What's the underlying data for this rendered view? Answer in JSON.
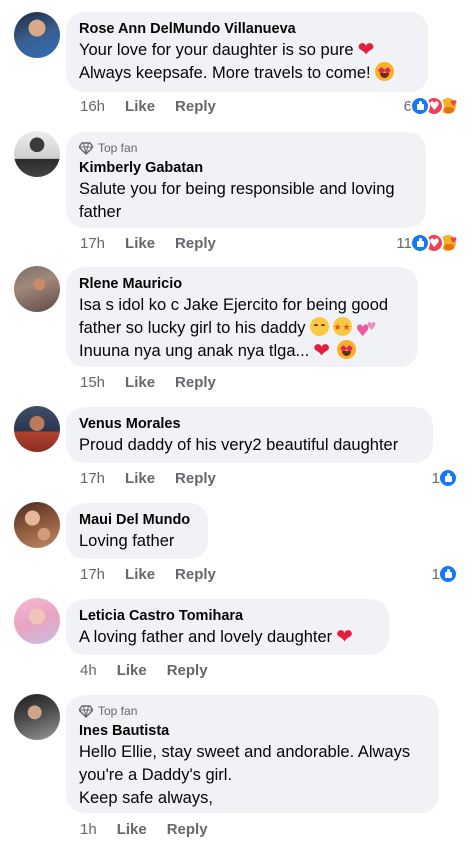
{
  "comments": [
    {
      "name": "Rose Ann DelMundo Villanueva",
      "top_fan": false,
      "lines": [
        "Your love for your daughter is so pure",
        "Always keepsafe. More travels to come!"
      ],
      "time": "16h",
      "like": "Like",
      "reply": "Reply",
      "reaction_count": "6",
      "reactions": [
        "like-icon",
        "love-icon",
        "care-icon"
      ]
    },
    {
      "name": "Kimberly Gabatan",
      "top_fan": true,
      "top_fan_label": "Top fan",
      "lines": [
        "Salute you for being responsible and loving",
        "father"
      ],
      "time": "17h",
      "like": "Like",
      "reply": "Reply",
      "reaction_count": "11",
      "reactions": [
        "like-icon",
        "love-icon",
        "care-icon"
      ]
    },
    {
      "name": "Rlene Mauricio",
      "top_fan": false,
      "lines": [
        "Isa s idol ko c Jake Ejercito for being good",
        "father so lucky girl to his daddy",
        "Inuuna nya ung anak nya tlga..."
      ],
      "time": "15h",
      "like": "Like",
      "reply": "Reply"
    },
    {
      "name": "Venus Morales",
      "top_fan": false,
      "lines": [
        "Proud daddy of his very2 beautiful daughter"
      ],
      "time": "17h",
      "like": "Like",
      "reply": "Reply",
      "reaction_count": "1",
      "reactions": [
        "like-icon"
      ]
    },
    {
      "name": "Maui Del Mundo",
      "top_fan": false,
      "lines": [
        "Loving father"
      ],
      "time": "17h",
      "like": "Like",
      "reply": "Reply",
      "reaction_count": "1",
      "reactions": [
        "like-icon"
      ]
    },
    {
      "name": "Leticia Castro Tomihara",
      "top_fan": false,
      "lines": [
        "A loving father and lovely daughter"
      ],
      "time": "4h",
      "like": "Like",
      "reply": "Reply"
    },
    {
      "name": "Ines Bautista",
      "top_fan": true,
      "top_fan_label": "Top fan",
      "lines": [
        "Hello Ellie, stay sweet and andorable. Always",
        "you're a Daddy's girl.",
        "Keep safe always,"
      ],
      "time": "1h",
      "like": "Like",
      "reply": "Reply"
    }
  ],
  "colors": {
    "bubble": "#f0f2f5",
    "meta": "#65676b",
    "like_blue": "#1877f2",
    "love_red": "#f33e58"
  }
}
